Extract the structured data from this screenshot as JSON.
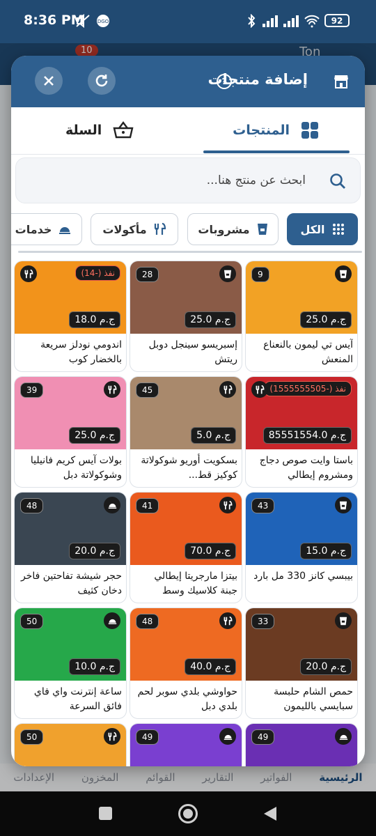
{
  "status_bar": {
    "time": "8:36 PM",
    "battery": "92"
  },
  "background_app": {
    "badge": "10",
    "top_right_text": "Ton",
    "nav": [
      "الرئيسية",
      "الفواتير",
      "التقارير",
      "القوائم",
      "المخزون",
      "الإعدادات"
    ]
  },
  "modal": {
    "title": "إضافة منتجات",
    "tabs": {
      "products": "المنتجات",
      "cart": "السلة"
    },
    "search_placeholder": "ابحث عن منتج هنا...",
    "filters": [
      "الكل",
      "مشروبات",
      "مأكولات",
      "خدمات"
    ]
  },
  "colors": {
    "accent": "#2e5f8f",
    "header": "#2e5f8f"
  },
  "products": [
    {
      "name": "آيس تي ليمون بالنعناع المنعش",
      "price": "25.0 ج.م",
      "stock": "9",
      "category": "cup-icon",
      "bg": "#f2a225"
    },
    {
      "name": "إسبريسو سينجل دوبل ريتش",
      "price": "25.0 ج.م",
      "stock": "28",
      "category": "cup-icon",
      "bg": "#8a5b47"
    },
    {
      "name": "اندومي نودلز سريعة بالخضار كوب",
      "price": "18.0 ج.م",
      "stock": "نفذ (-14)",
      "category": "utensils-icon",
      "bg": "#f2931b"
    },
    {
      "name": "باستا وايت صوص دجاج ومشروم إيطالي",
      "price": "85551554.0 ج.م",
      "stock": "نفذ (-1555555505)",
      "category": "utensils-icon",
      "bg": "#c8262b"
    },
    {
      "name": "بسكويت أوريو شوكولاتة كوكيز قط...",
      "price": "5.0 ج.م",
      "stock": "45",
      "category": "utensils-icon",
      "bg": "#a9896c"
    },
    {
      "name": "بولات آيس كريم فانيليا وشوكولاتة دبل",
      "price": "25.0 ج.م",
      "stock": "39",
      "category": "utensils-icon",
      "bg": "#f08fb3"
    },
    {
      "name": "بيبسي كانز 330 مل بارد",
      "price": "15.0 ج.م",
      "stock": "43",
      "category": "cup-icon",
      "bg": "#1f63b8"
    },
    {
      "name": "بيتزا مارجريتا إيطالي جبنة كلاسيك وسط",
      "price": "70.0 ج.م",
      "stock": "41",
      "category": "utensils-icon",
      "bg": "#ea5a1e"
    },
    {
      "name": "حجر شيشة تفاحتين فاخر دخان كثيف",
      "price": "20.0 ج.م",
      "stock": "48",
      "category": "service-icon",
      "bg": "#3a4652"
    },
    {
      "name": "حمص الشام حلبسة سبايسي بالليمون",
      "price": "20.0 ج.م",
      "stock": "33",
      "category": "cup-icon",
      "bg": "#6b3b22"
    },
    {
      "name": "حواوشي بلدي سوبر لحم بلدي دبل",
      "price": "40.0 ج.م",
      "stock": "48",
      "category": "utensils-icon",
      "bg": "#ee6a22"
    },
    {
      "name": "ساعة إنترنت واي فاي فائق السرعة",
      "price": "10.0 ج.م",
      "stock": "50",
      "category": "service-icon",
      "bg": "#26a84a"
    },
    {
      "name": "",
      "price": "",
      "stock": "49",
      "category": "service-icon",
      "bg": "#6a2fb3"
    },
    {
      "name": "",
      "price": "",
      "stock": "49",
      "category": "service-icon",
      "bg": "#7a3fd0"
    },
    {
      "name": "",
      "price": "",
      "stock": "50",
      "category": "utensils-icon",
      "bg": "#f0a12d"
    }
  ]
}
